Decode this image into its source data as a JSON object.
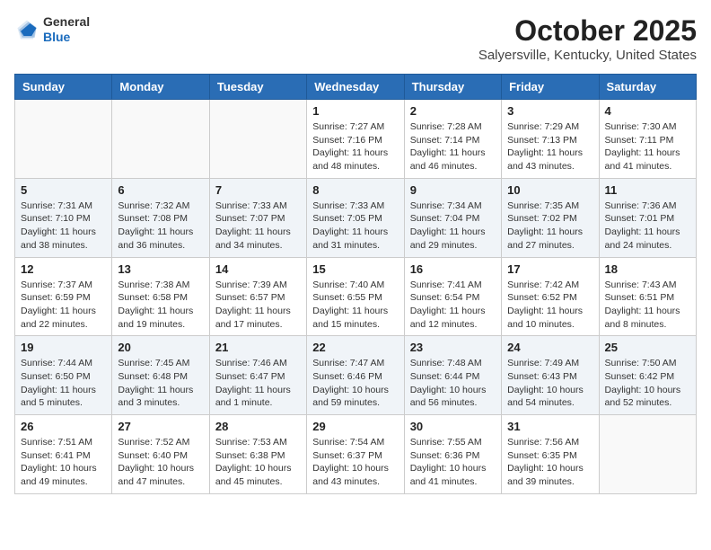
{
  "header": {
    "logo_general": "General",
    "logo_blue": "Blue",
    "month_title": "October 2025",
    "location": "Salyersville, Kentucky, United States"
  },
  "days_of_week": [
    "Sunday",
    "Monday",
    "Tuesday",
    "Wednesday",
    "Thursday",
    "Friday",
    "Saturday"
  ],
  "weeks": [
    [
      {
        "day": "",
        "info": ""
      },
      {
        "day": "",
        "info": ""
      },
      {
        "day": "",
        "info": ""
      },
      {
        "day": "1",
        "info": "Sunrise: 7:27 AM\nSunset: 7:16 PM\nDaylight: 11 hours\nand 48 minutes."
      },
      {
        "day": "2",
        "info": "Sunrise: 7:28 AM\nSunset: 7:14 PM\nDaylight: 11 hours\nand 46 minutes."
      },
      {
        "day": "3",
        "info": "Sunrise: 7:29 AM\nSunset: 7:13 PM\nDaylight: 11 hours\nand 43 minutes."
      },
      {
        "day": "4",
        "info": "Sunrise: 7:30 AM\nSunset: 7:11 PM\nDaylight: 11 hours\nand 41 minutes."
      }
    ],
    [
      {
        "day": "5",
        "info": "Sunrise: 7:31 AM\nSunset: 7:10 PM\nDaylight: 11 hours\nand 38 minutes."
      },
      {
        "day": "6",
        "info": "Sunrise: 7:32 AM\nSunset: 7:08 PM\nDaylight: 11 hours\nand 36 minutes."
      },
      {
        "day": "7",
        "info": "Sunrise: 7:33 AM\nSunset: 7:07 PM\nDaylight: 11 hours\nand 34 minutes."
      },
      {
        "day": "8",
        "info": "Sunrise: 7:33 AM\nSunset: 7:05 PM\nDaylight: 11 hours\nand 31 minutes."
      },
      {
        "day": "9",
        "info": "Sunrise: 7:34 AM\nSunset: 7:04 PM\nDaylight: 11 hours\nand 29 minutes."
      },
      {
        "day": "10",
        "info": "Sunrise: 7:35 AM\nSunset: 7:02 PM\nDaylight: 11 hours\nand 27 minutes."
      },
      {
        "day": "11",
        "info": "Sunrise: 7:36 AM\nSunset: 7:01 PM\nDaylight: 11 hours\nand 24 minutes."
      }
    ],
    [
      {
        "day": "12",
        "info": "Sunrise: 7:37 AM\nSunset: 6:59 PM\nDaylight: 11 hours\nand 22 minutes."
      },
      {
        "day": "13",
        "info": "Sunrise: 7:38 AM\nSunset: 6:58 PM\nDaylight: 11 hours\nand 19 minutes."
      },
      {
        "day": "14",
        "info": "Sunrise: 7:39 AM\nSunset: 6:57 PM\nDaylight: 11 hours\nand 17 minutes."
      },
      {
        "day": "15",
        "info": "Sunrise: 7:40 AM\nSunset: 6:55 PM\nDaylight: 11 hours\nand 15 minutes."
      },
      {
        "day": "16",
        "info": "Sunrise: 7:41 AM\nSunset: 6:54 PM\nDaylight: 11 hours\nand 12 minutes."
      },
      {
        "day": "17",
        "info": "Sunrise: 7:42 AM\nSunset: 6:52 PM\nDaylight: 11 hours\nand 10 minutes."
      },
      {
        "day": "18",
        "info": "Sunrise: 7:43 AM\nSunset: 6:51 PM\nDaylight: 11 hours\nand 8 minutes."
      }
    ],
    [
      {
        "day": "19",
        "info": "Sunrise: 7:44 AM\nSunset: 6:50 PM\nDaylight: 11 hours\nand 5 minutes."
      },
      {
        "day": "20",
        "info": "Sunrise: 7:45 AM\nSunset: 6:48 PM\nDaylight: 11 hours\nand 3 minutes."
      },
      {
        "day": "21",
        "info": "Sunrise: 7:46 AM\nSunset: 6:47 PM\nDaylight: 11 hours\nand 1 minute."
      },
      {
        "day": "22",
        "info": "Sunrise: 7:47 AM\nSunset: 6:46 PM\nDaylight: 10 hours\nand 59 minutes."
      },
      {
        "day": "23",
        "info": "Sunrise: 7:48 AM\nSunset: 6:44 PM\nDaylight: 10 hours\nand 56 minutes."
      },
      {
        "day": "24",
        "info": "Sunrise: 7:49 AM\nSunset: 6:43 PM\nDaylight: 10 hours\nand 54 minutes."
      },
      {
        "day": "25",
        "info": "Sunrise: 7:50 AM\nSunset: 6:42 PM\nDaylight: 10 hours\nand 52 minutes."
      }
    ],
    [
      {
        "day": "26",
        "info": "Sunrise: 7:51 AM\nSunset: 6:41 PM\nDaylight: 10 hours\nand 49 minutes."
      },
      {
        "day": "27",
        "info": "Sunrise: 7:52 AM\nSunset: 6:40 PM\nDaylight: 10 hours\nand 47 minutes."
      },
      {
        "day": "28",
        "info": "Sunrise: 7:53 AM\nSunset: 6:38 PM\nDaylight: 10 hours\nand 45 minutes."
      },
      {
        "day": "29",
        "info": "Sunrise: 7:54 AM\nSunset: 6:37 PM\nDaylight: 10 hours\nand 43 minutes."
      },
      {
        "day": "30",
        "info": "Sunrise: 7:55 AM\nSunset: 6:36 PM\nDaylight: 10 hours\nand 41 minutes."
      },
      {
        "day": "31",
        "info": "Sunrise: 7:56 AM\nSunset: 6:35 PM\nDaylight: 10 hours\nand 39 minutes."
      },
      {
        "day": "",
        "info": ""
      }
    ]
  ]
}
